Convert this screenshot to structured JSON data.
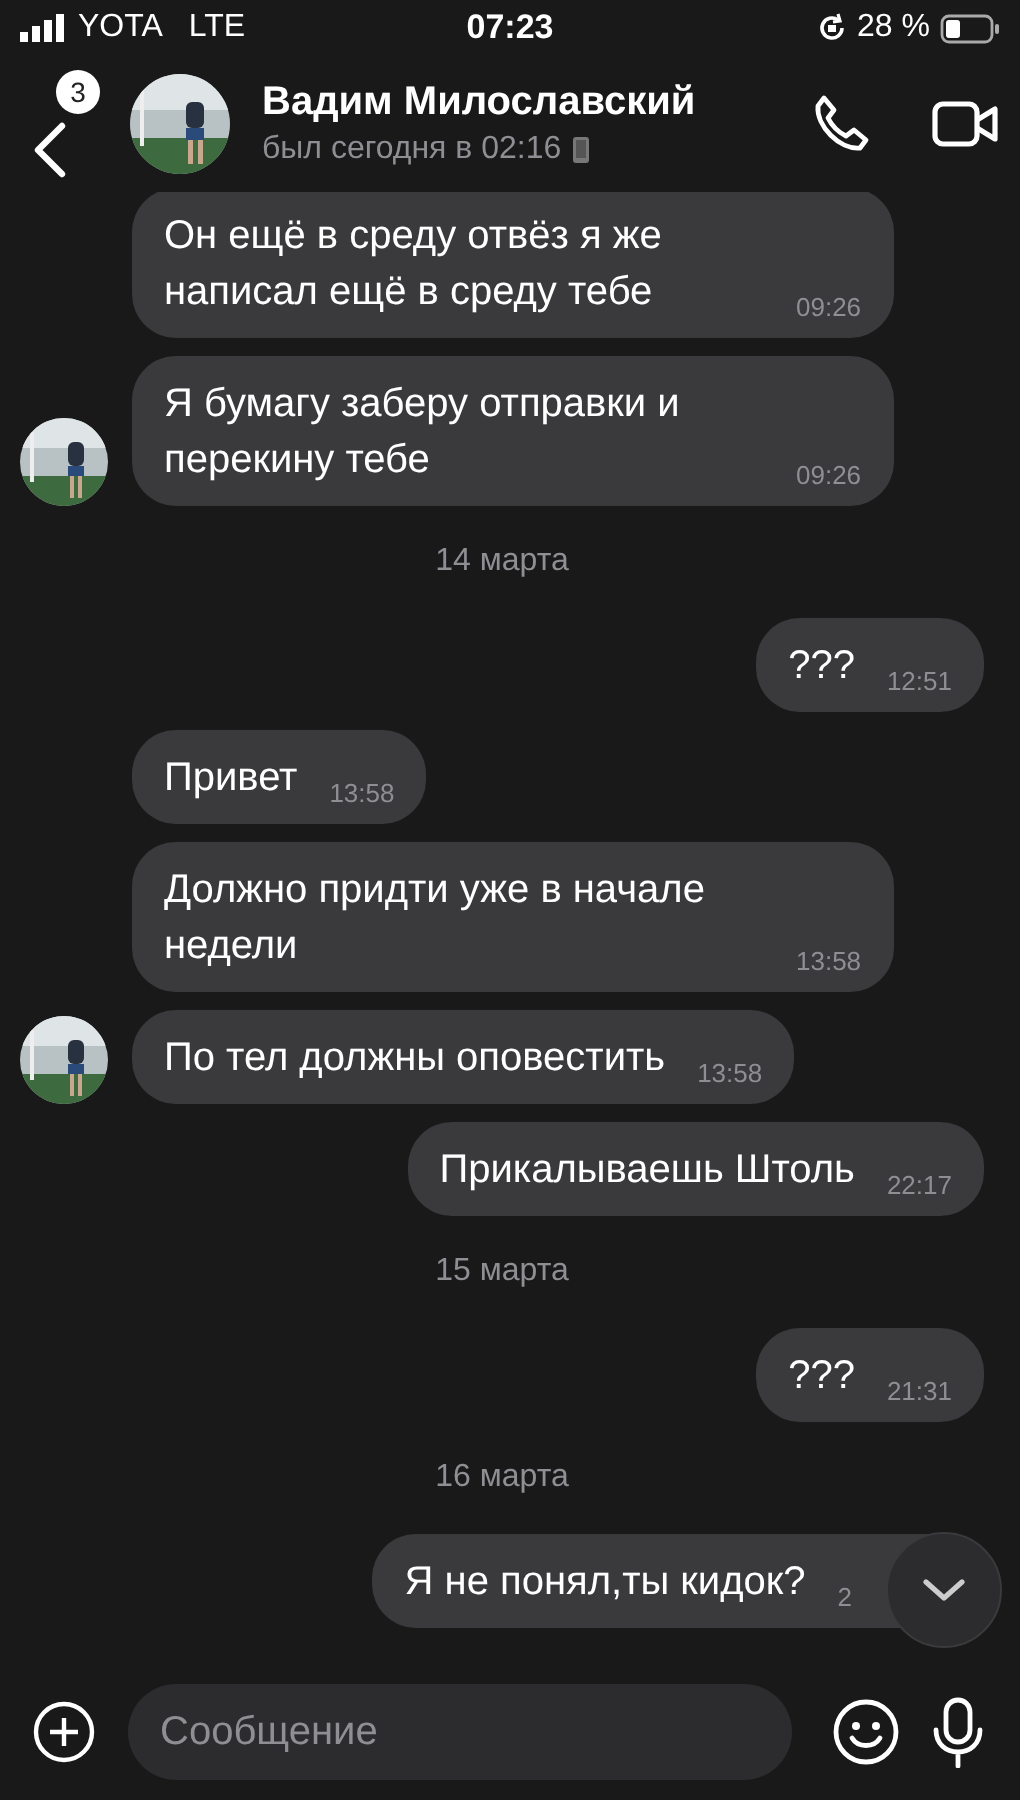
{
  "status_bar": {
    "carrier": "YOTA",
    "network": "LTE",
    "time": "07:23",
    "battery": "28 %"
  },
  "header": {
    "unread": "3",
    "name": "Вадим Милославский",
    "last_seen": "был сегодня в 02:16"
  },
  "messages": [
    {
      "kind": "message",
      "outgoing": false,
      "avatar": false,
      "text": "Он ещё в среду отвёз я же написал ещё в среду тебе",
      "time": "09:26"
    },
    {
      "kind": "message",
      "outgoing": false,
      "avatar": true,
      "text": "Я бумагу заберу отправки и перекину тебе",
      "time": "09:26"
    },
    {
      "kind": "date",
      "text": "14 марта"
    },
    {
      "kind": "message",
      "outgoing": true,
      "text": "???",
      "time": "12:51"
    },
    {
      "kind": "message",
      "outgoing": false,
      "avatar": false,
      "text": "Привет",
      "time": "13:58"
    },
    {
      "kind": "message",
      "outgoing": false,
      "avatar": false,
      "text": "Должно придти уже в начале недели",
      "time": "13:58"
    },
    {
      "kind": "message",
      "outgoing": false,
      "avatar": true,
      "text": "По тел должны оповестить",
      "time": "13:58"
    },
    {
      "kind": "message",
      "outgoing": true,
      "text": "Прикалываешь Штоль",
      "time": "22:17"
    },
    {
      "kind": "date",
      "text": "15 марта"
    },
    {
      "kind": "message",
      "outgoing": true,
      "text": "???",
      "time": "21:31"
    },
    {
      "kind": "date",
      "text": "16 марта"
    },
    {
      "kind": "message",
      "outgoing": true,
      "text": "Я не понял,ты кидок?",
      "time": "2"
    }
  ],
  "composer": {
    "placeholder": "Сообщение"
  }
}
